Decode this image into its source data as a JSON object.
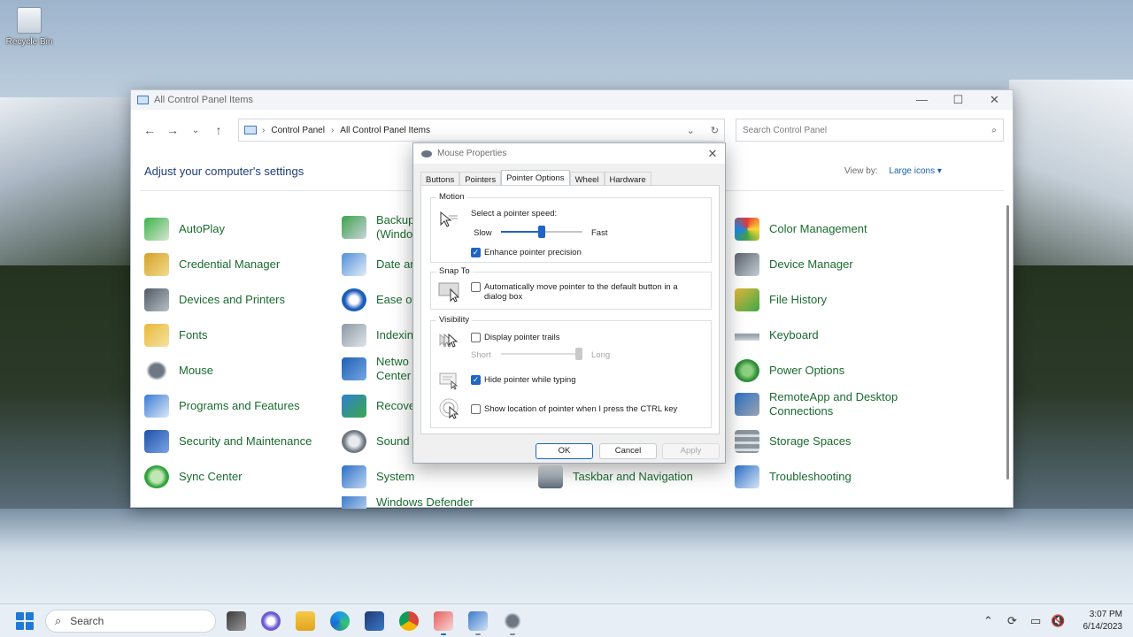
{
  "desktop": {
    "recycle_bin_label": "Recycle Bin"
  },
  "window": {
    "title": "All Control Panel Items",
    "controls": {
      "minimize": "—",
      "maximize": "☐",
      "close": "✕"
    },
    "breadcrumb": [
      "Control Panel",
      "All Control Panel Items"
    ],
    "search_placeholder": "Search Control Panel",
    "heading": "Adjust your computer's settings",
    "view_by_label": "View by:",
    "view_by_value": "Large icons ▾",
    "items_col1": [
      "AutoPlay",
      "Credential Manager",
      "Devices and Printers",
      "Fonts",
      "Mouse",
      "Programs and Features",
      "Security and Maintenance",
      "Sync Center"
    ],
    "items_col2": [
      "Backup",
      "(Windo",
      "Date ar",
      "Ease of",
      "Indexin",
      "Netwo",
      "Center",
      "Recove",
      "Sound",
      "System",
      "Windows Defender"
    ],
    "items_col3": [
      "Taskbar and Navigation"
    ],
    "items_col4": [
      "Color Management",
      "Device Manager",
      "File History",
      "Keyboard",
      "Power Options",
      "RemoteApp and Desktop",
      "Connections",
      "Storage Spaces",
      "Troubleshooting"
    ]
  },
  "dialog": {
    "title": "Mouse Properties",
    "close": "✕",
    "tabs": [
      "Buttons",
      "Pointers",
      "Pointer Options",
      "Wheel",
      "Hardware"
    ],
    "active_tab": "Pointer Options",
    "motion": {
      "label": "Motion",
      "speed_label": "Select a pointer speed:",
      "slow": "Slow",
      "fast": "Fast",
      "speed_fraction": 0.5,
      "enhance_label": "Enhance pointer precision",
      "enhance_checked": true
    },
    "snap_to": {
      "label": "Snap To",
      "auto_move_line1": "Automatically move pointer to the default button in a",
      "auto_move_line2": "dialog box",
      "auto_move_checked": false
    },
    "visibility": {
      "label": "Visibility",
      "trails_label": "Display pointer trails",
      "trails_checked": false,
      "short": "Short",
      "long": "Long",
      "trail_fraction": 1.0,
      "hide_label": "Hide pointer while typing",
      "hide_checked": true,
      "show_location_label": "Show location of pointer when I press the CTRL key",
      "show_location_checked": false
    },
    "buttons": {
      "ok": "OK",
      "cancel": "Cancel",
      "apply": "Apply"
    }
  },
  "taskbar": {
    "search_label": "Search",
    "time": "3:07 PM",
    "date": "6/14/2023"
  },
  "colors": {
    "accent": "#1f64c6",
    "link_green": "#1a6b30",
    "heading_blue": "#1e3c7a"
  }
}
